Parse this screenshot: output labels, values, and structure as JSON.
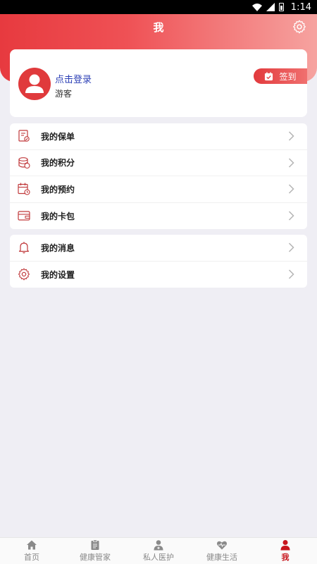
{
  "status_bar": {
    "time": "1:14"
  },
  "header": {
    "title": "我"
  },
  "profile": {
    "login_label": "点击登录",
    "guest_label": "游客",
    "checkin_label": "签到"
  },
  "menu_groups": [
    {
      "items": [
        {
          "label": "我的保单",
          "icon": "policy-doc-icon"
        },
        {
          "label": "我的积分",
          "icon": "coins-icon"
        },
        {
          "label": "我的预约",
          "icon": "calendar-icon"
        },
        {
          "label": "我的卡包",
          "icon": "wallet-icon"
        }
      ]
    },
    {
      "items": [
        {
          "label": "我的消息",
          "icon": "bell-icon"
        },
        {
          "label": "我的设置",
          "icon": "gear-icon"
        }
      ]
    }
  ],
  "bottom_nav": {
    "items": [
      {
        "label": "首页",
        "icon": "home-icon",
        "active": false
      },
      {
        "label": "健康管家",
        "icon": "clipboard-icon",
        "active": false
      },
      {
        "label": "私人医护",
        "icon": "doctor-icon",
        "active": false
      },
      {
        "label": "健康生活",
        "icon": "heartbeat-icon",
        "active": false
      },
      {
        "label": "我",
        "icon": "user-icon",
        "active": true
      }
    ]
  },
  "colors": {
    "brand_red": "#e73a3f",
    "link_blue": "#2b3fb5",
    "background": "#efeef4"
  }
}
